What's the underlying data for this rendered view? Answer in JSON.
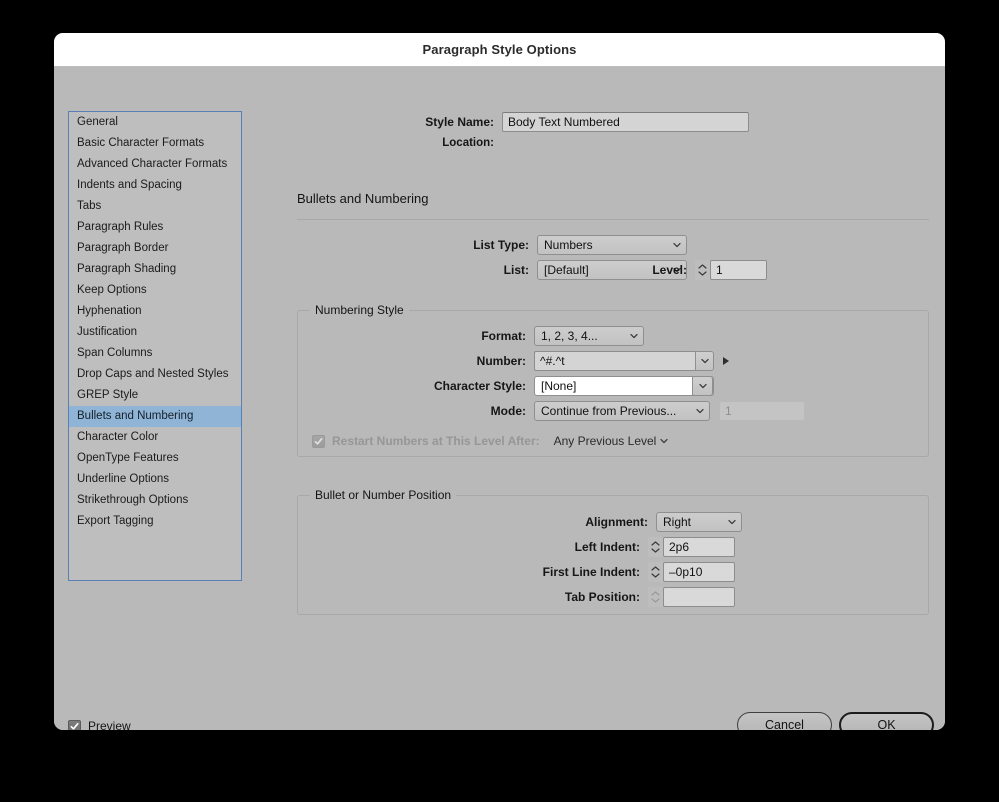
{
  "window": {
    "title": "Paragraph Style Options"
  },
  "sidebar": {
    "items": [
      {
        "label": "General",
        "selected": false
      },
      {
        "label": "Basic Character Formats",
        "selected": false
      },
      {
        "label": "Advanced Character Formats",
        "selected": false
      },
      {
        "label": "Indents and Spacing",
        "selected": false
      },
      {
        "label": "Tabs",
        "selected": false
      },
      {
        "label": "Paragraph Rules",
        "selected": false
      },
      {
        "label": "Paragraph Border",
        "selected": false
      },
      {
        "label": "Paragraph Shading",
        "selected": false
      },
      {
        "label": "Keep Options",
        "selected": false
      },
      {
        "label": "Hyphenation",
        "selected": false
      },
      {
        "label": "Justification",
        "selected": false
      },
      {
        "label": "Span Columns",
        "selected": false
      },
      {
        "label": "Drop Caps and Nested Styles",
        "selected": false
      },
      {
        "label": "GREP Style",
        "selected": false
      },
      {
        "label": "Bullets and Numbering",
        "selected": true
      },
      {
        "label": "Character Color",
        "selected": false
      },
      {
        "label": "OpenType Features",
        "selected": false
      },
      {
        "label": "Underline Options",
        "selected": false
      },
      {
        "label": "Strikethrough Options",
        "selected": false
      },
      {
        "label": "Export Tagging",
        "selected": false
      }
    ]
  },
  "header": {
    "style_name_label": "Style Name:",
    "style_name_value": "Body Text Numbered",
    "style_name_placeholder": "Style Name",
    "location_label": "Location:",
    "location_value": "",
    "section_title": "Bullets and Numbering"
  },
  "list_settings": {
    "list_type_label": "List Type:",
    "list_type_value": "Numbers",
    "list_label": "List:",
    "list_value": "[Default]",
    "level_label": "Level:",
    "level_value": "1"
  },
  "numbering_style": {
    "group_title": "Numbering Style",
    "format_label": "Format:",
    "format_value": "1, 2, 3, 4...",
    "number_label": "Number:",
    "number_value": "^#.^t",
    "character_style_label": "Character Style:",
    "character_style_value": "[None]",
    "mode_label": "Mode:",
    "mode_value": "Continue from Previous...",
    "mode_number_value": "1",
    "restart_label": "Restart Numbers at This Level After:",
    "restart_checked": true,
    "restart_value": "Any Previous Level"
  },
  "position": {
    "group_title": "Bullet or Number Position",
    "alignment_label": "Alignment:",
    "alignment_value": "Right",
    "left_indent_label": "Left Indent:",
    "left_indent_value": "2p6",
    "first_line_indent_label": "First Line Indent:",
    "first_line_indent_value": "–0p10",
    "tab_position_label": "Tab Position:",
    "tab_position_value": ""
  },
  "footer": {
    "preview_label": "Preview",
    "preview_checked": true,
    "cancel_label": "Cancel",
    "ok_label": "OK"
  },
  "colors": {
    "dialog_bg": "#b9b9b9",
    "titlebar_bg": "#ffffff",
    "selection_blue": "#8fb4d6",
    "sidebar_border": "#5b7fb5",
    "field_bg": "#d4d4d4",
    "desktop_bg": "#000000"
  }
}
